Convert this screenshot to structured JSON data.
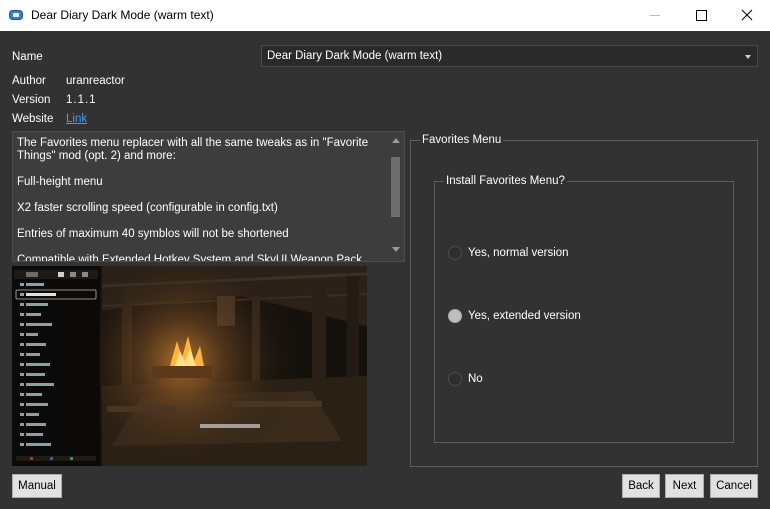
{
  "window": {
    "title": "Dear Diary Dark Mode (warm text)"
  },
  "fields": {
    "name_label": "Name",
    "name_value": "Dear Diary Dark Mode (warm text)",
    "author_label": "Author",
    "author_value": "uranreactor",
    "version_label": "Version",
    "version_value": "1.1.1",
    "website_label": "Website",
    "website_link": "Link"
  },
  "description": {
    "paragraphs": [
      "The Favorites menu replacer with all the same tweaks as in \"Favorite Things\" mod (opt. 2) and more:",
      "Full-height menu",
      "X2 faster scrolling speed (configurable in config.txt)",
      "Entries of maximum 40 symblos will not be shortened",
      "Compatible with Extended Hotkey System and SkyUI Weapon Pack mods"
    ]
  },
  "options": {
    "group_title": "Favorites Menu",
    "subgroup_title": "Install Favorites Menu?",
    "choices": [
      {
        "label": "Yes, normal version",
        "selected": false
      },
      {
        "label": "Yes, extended version",
        "selected": true
      },
      {
        "label": "No",
        "selected": false
      }
    ]
  },
  "buttons": {
    "manual": "Manual",
    "back": "Back",
    "next": "Next",
    "cancel": "Cancel"
  }
}
